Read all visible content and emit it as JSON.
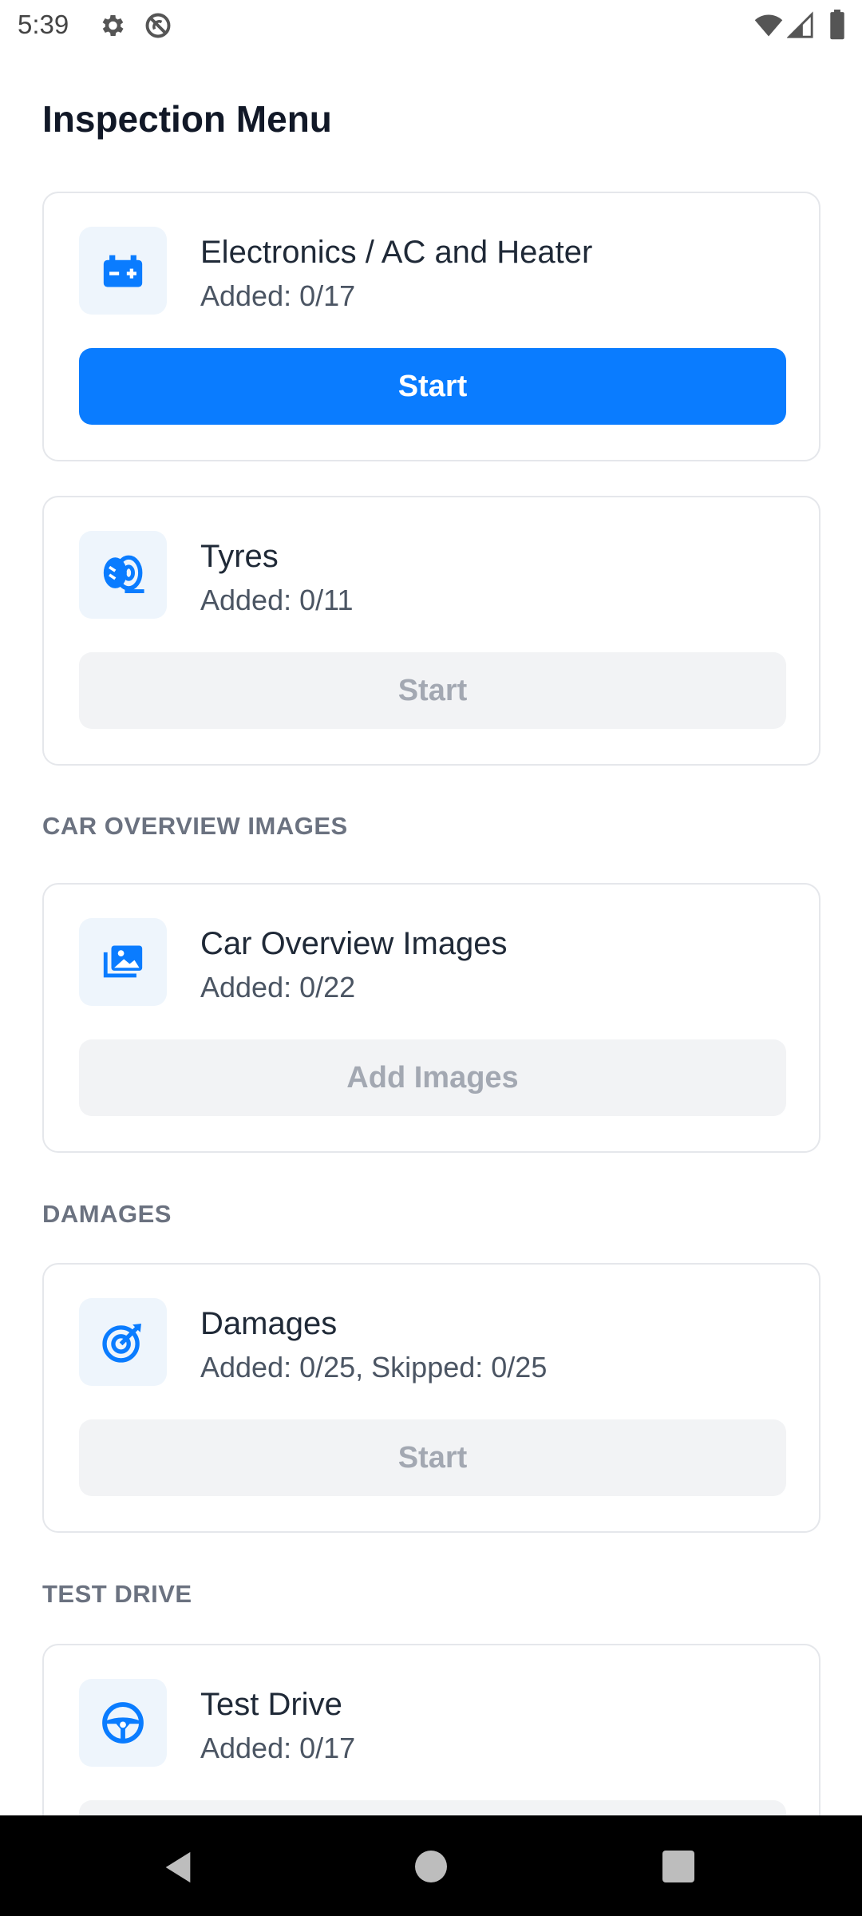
{
  "status_bar": {
    "time": "5:39",
    "icons": [
      "gear-icon",
      "do-not-disturb-icon",
      "wifi-icon",
      "signal-icon",
      "battery-icon"
    ]
  },
  "page": {
    "title": "Inspection Menu"
  },
  "colors": {
    "accent": "#0a7cff",
    "icon_bg": "#eef5fc",
    "disabled_bg": "#f2f3f5",
    "disabled_text": "#a3a8b2",
    "section_text": "#6b7280"
  },
  "sections": {
    "car_overview": "CAR OVERVIEW IMAGES",
    "damages": "DAMAGES",
    "test_drive": "TEST DRIVE"
  },
  "cards": {
    "electronics": {
      "icon": "battery-icon",
      "title": "Electronics / AC and Heater",
      "subtitle": "Added: 0/17",
      "button": "Start",
      "enabled": true
    },
    "tyres": {
      "icon": "tyre-icon",
      "title": "Tyres",
      "subtitle": "Added: 0/11",
      "button": "Start",
      "enabled": false
    },
    "car_overview": {
      "icon": "images-icon",
      "title": "Car Overview Images",
      "subtitle": "Added: 0/22",
      "button": "Add Images",
      "enabled": false
    },
    "damages": {
      "icon": "target-icon",
      "title": "Damages",
      "subtitle": "Added: 0/25, Skipped: 0/25",
      "button": "Start",
      "enabled": false
    },
    "test_drive": {
      "icon": "steering-wheel-icon",
      "title": "Test Drive",
      "subtitle": "Added: 0/17"
    }
  },
  "nav_bar": {
    "icons": [
      "back-icon",
      "home-icon",
      "recents-icon"
    ]
  }
}
